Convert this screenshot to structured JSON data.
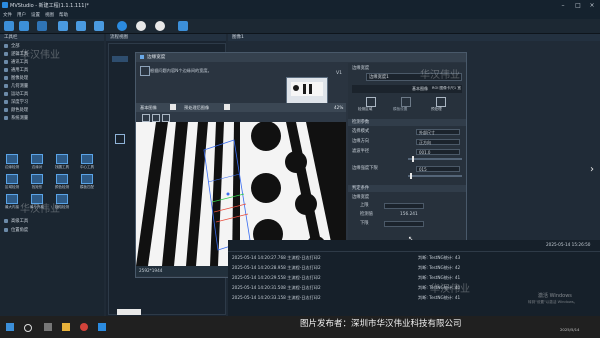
{
  "window": {
    "title": "MVStudio - 新建工程(1.1.1.111)*"
  },
  "menu": [
    "文件",
    "用户",
    "设置",
    "视图",
    "帮助"
  ],
  "left_panel": {
    "header": "工具栏",
    "tools": [
      "全部",
      "逻辑工具",
      "通讯工具",
      "通用工具",
      "图像处理",
      "几何测量",
      "运动工具",
      "深度学习",
      "颜色处理",
      "系统测量"
    ],
    "grid_tools": [
      "边缘检测",
      "边缘对",
      "找圆工具",
      "找直线",
      "中心工具",
      "区域检测",
      "找矩形",
      "颜色检测",
      "角度检测",
      "模板匹配",
      "最大内接",
      "最小外接",
      "缺陷检测"
    ],
    "bottom_items": [
      "高级工具",
      "位置角度"
    ]
  },
  "process_panel": {
    "header": "流程视图"
  },
  "main_area": {
    "header": "图像1"
  },
  "dialog": {
    "title": "边缘宽度",
    "desc": "根据问题内容N个边缘间的宽度。",
    "version": "V1",
    "tab_input": "基本图像",
    "tab_preview": "预处理后图像",
    "zoom": "42%",
    "image_size": "2592*1944",
    "pixel_pos": "(2084, 613)",
    "pixel_val": "232",
    "right": {
      "name_label": "边缘宽度",
      "name_value": "边缘宽度1",
      "tab1": "基本图像",
      "tab2": "ROI 图像卡尺1 宽",
      "icons": [
        "检测区域",
        "模板设置",
        "预处理"
      ],
      "section_params": "检测参数",
      "params": [
        {
          "label": "选择模式",
          "value": "外部尺寸"
        },
        {
          "label": "边缘方向",
          "value": "正方向"
        },
        {
          "label": "滤波半径",
          "value": "001.0"
        },
        {
          "label": "边缘强度下限",
          "value": "015"
        }
      ],
      "section_judge": "判定条件",
      "judge_header": "边缘宽度",
      "judge": [
        {
          "label": "上限",
          "value": ""
        },
        {
          "label": "检测值",
          "value": "156.241"
        },
        {
          "label": "下限",
          "value": ""
        }
      ],
      "ok_label": "确定",
      "cancel_label": "取消"
    }
  },
  "log": {
    "timestamp": "2025-05-14 15:26:50",
    "left_rows": [
      "2025-05-14 14:20:27.768 主流程-日志打印2",
      "2025-05-14 14:20:28.958 主流程-日志打印2",
      "2025-05-14 14:20:29.558 主流程-日志打印2",
      "2025-05-14 14:20:31.508 主流程-日志打印2",
      "2025-05-14 14:20:33.158 主流程-日志打印2"
    ],
    "right_rows": [
      "判断: TestNG统计: 43",
      "判断: TestNG统计: 42",
      "判断: TestNG统计: 41",
      "判断: TestNG统计: 40",
      "判断: TestNG统计: 41"
    ]
  },
  "watermarks": [
    "华汉伟业",
    "华汉伟业",
    "华汉伟业",
    "华汉伟业"
  ],
  "activation": {
    "line1": "激活 Windows",
    "line2": "转到\"设置\"以激活 Windows。"
  },
  "taskbar": {
    "date": "2025/5/14"
  },
  "publisher": "图片发布者：深圳市华汉伟业科技有限公司",
  "colors": {
    "accent": "#2b8be0",
    "ok_button": "#2d6db5",
    "title_bar": "#15222e"
  }
}
